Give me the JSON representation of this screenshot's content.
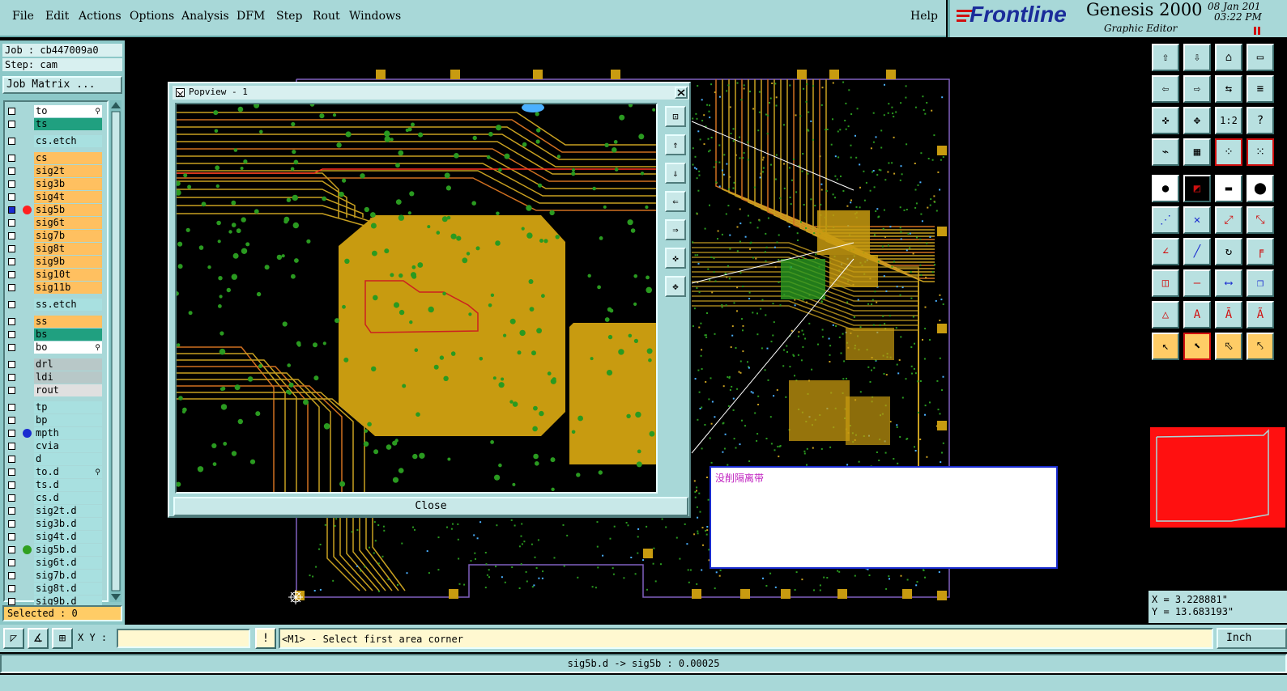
{
  "menu": {
    "items": [
      "File",
      "Edit",
      "Actions",
      "Options",
      "Analysis",
      "DFM",
      "Step",
      "Rout",
      "Windows"
    ],
    "help": "Help"
  },
  "logo": {
    "brand": "Frontline",
    "product": "Genesis 2000",
    "subtitle": "Graphic Editor",
    "date": "08 Jan 201",
    "time": "03:22 PM"
  },
  "job": {
    "job_label": "Job : cb447009a0",
    "step_label": "Step: cam",
    "matrix_button": "Job Matrix ..."
  },
  "layers": [
    {
      "name": "to",
      "color": "#ffffff",
      "lock": true
    },
    {
      "name": "ts",
      "color": "#20a080"
    },
    {
      "name": "cs.etch",
      "color": "#a8e0e0",
      "gap": true
    },
    {
      "name": "cs",
      "color": "#ffc060",
      "gap": true
    },
    {
      "name": "sig2t",
      "color": "#ffc060"
    },
    {
      "name": "sig3b",
      "color": "#ffc060"
    },
    {
      "name": "sig4t",
      "color": "#ffc060"
    },
    {
      "name": "sig5b",
      "color": "#ffc060",
      "dot": "#ff2020",
      "selected": true
    },
    {
      "name": "sig6t",
      "color": "#ffc060"
    },
    {
      "name": "sig7b",
      "color": "#ffc060"
    },
    {
      "name": "sig8t",
      "color": "#ffc060"
    },
    {
      "name": "sig9b",
      "color": "#ffc060"
    },
    {
      "name": "sig10t",
      "color": "#ffc060"
    },
    {
      "name": "sig11b",
      "color": "#ffc060"
    },
    {
      "name": "ss.etch",
      "color": "#a8e0e0",
      "gap": true
    },
    {
      "name": "ss",
      "color": "#ffc060",
      "gap": true
    },
    {
      "name": "bs",
      "color": "#20a080"
    },
    {
      "name": "bo",
      "color": "#ffffff",
      "lock": true
    },
    {
      "name": "drl",
      "color": "#b8c8c8",
      "gap": true
    },
    {
      "name": "ldi",
      "color": "#b8c8c8"
    },
    {
      "name": "rout",
      "color": "#e0e0e0"
    },
    {
      "name": "tp",
      "color": "#a8e0e0",
      "gap": true
    },
    {
      "name": "bp",
      "color": "#a8e0e0"
    },
    {
      "name": "mpth",
      "color": "#a8e0e0",
      "dot": "#1a2cd0"
    },
    {
      "name": "cvia",
      "color": "#a8e0e0"
    },
    {
      "name": "d",
      "color": "#a8e0e0"
    },
    {
      "name": "to.d",
      "color": "#a8e0e0",
      "lock": true
    },
    {
      "name": "ts.d",
      "color": "#a8e0e0"
    },
    {
      "name": "cs.d",
      "color": "#a8e0e0"
    },
    {
      "name": "sig2t.d",
      "color": "#a8e0e0"
    },
    {
      "name": "sig3b.d",
      "color": "#a8e0e0"
    },
    {
      "name": "sig4t.d",
      "color": "#a8e0e0"
    },
    {
      "name": "sig5b.d",
      "color": "#a8e0e0",
      "dot": "#30a020"
    },
    {
      "name": "sig6t.d",
      "color": "#a8e0e0"
    },
    {
      "name": "sig7b.d",
      "color": "#a8e0e0"
    },
    {
      "name": "sig8t.d",
      "color": "#a8e0e0"
    },
    {
      "name": "sig9b.d",
      "color": "#a8e0e0"
    }
  ],
  "selected_label": "Selected : 0",
  "popview": {
    "title": "Popview - 1",
    "close_label": "Close"
  },
  "message": {
    "text": "没削隔离带"
  },
  "coords": {
    "x": "X = 3.228881\"",
    "y": "Y = 13.683193\""
  },
  "bottom": {
    "xy_label": "X Y :",
    "xy_value": "",
    "prompt": "<M1> - Select first area corner",
    "units": "Inch"
  },
  "status": {
    "text": "sig5b.d -> sig5b : 0.00025"
  },
  "colors": {
    "panel": "#a8d8d8",
    "copper": "#c89b10",
    "trace": "#c8a020",
    "pad_green": "#2a9a20",
    "highlight_red": "#ff0000",
    "message_text": "#c020c0"
  }
}
